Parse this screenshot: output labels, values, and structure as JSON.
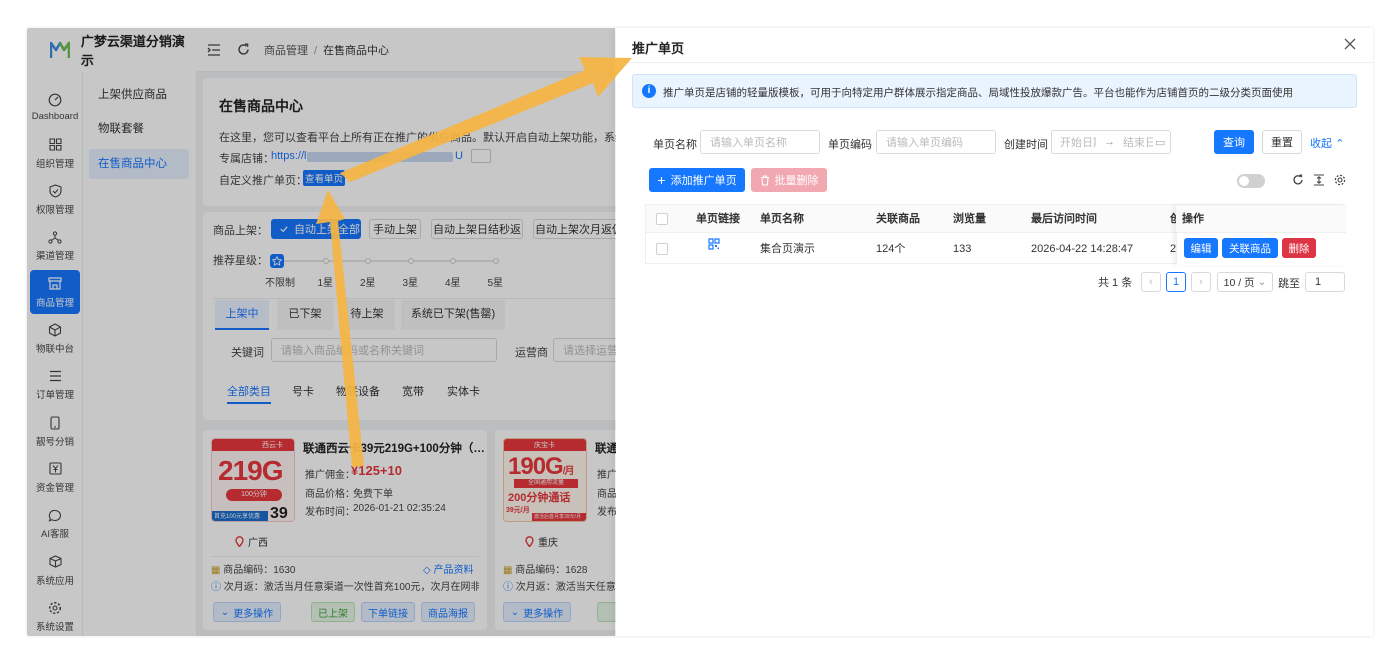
{
  "app": {
    "name": "广梦云渠道分销演示"
  },
  "rail": [
    {
      "label": "Dashboard",
      "icon": "dashboard-icon"
    },
    {
      "label": "组织管理",
      "icon": "grid-icon"
    },
    {
      "label": "权限管理",
      "icon": "shield-icon"
    },
    {
      "label": "渠道管理",
      "icon": "network-icon"
    },
    {
      "label": "商品管理",
      "icon": "store-icon",
      "active": true
    },
    {
      "label": "物联中台",
      "icon": "cube-icon"
    },
    {
      "label": "订单管理",
      "icon": "list-icon"
    },
    {
      "label": "靓号分销",
      "icon": "phone-icon"
    },
    {
      "label": "资金管理",
      "icon": "yen-icon"
    },
    {
      "label": "AI客服",
      "icon": "chat-icon"
    },
    {
      "label": "系统应用",
      "icon": "box-icon"
    },
    {
      "label": "系统设置",
      "icon": "gear-icon"
    }
  ],
  "submenu": [
    {
      "label": "上架供应商品"
    },
    {
      "label": "物联套餐"
    },
    {
      "label": "在售商品中心",
      "active": true
    }
  ],
  "breadcrumb": {
    "a": "商品管理",
    "sep": "/",
    "b": "在售商品中心"
  },
  "main": {
    "title": "在售商品中心",
    "desc": "在这里，您可以查看平台上所有正在推广的供应商品。默认开启自动上架功能，系统会将平台",
    "shop_label": "专属店铺：",
    "shop_url": "https://l",
    "shop_url_tail": "U",
    "custom_label": "自定义推广单页：",
    "view_btn": "查看单页",
    "shelf_label": "商品上架：",
    "shelf_opts": [
      "自动上架全部",
      "手动上架",
      "自动上架日结秒返",
      "自动上架次月返佣"
    ],
    "star_label": "推荐星级：",
    "stars": [
      "不限制",
      "1星",
      "2星",
      "3星",
      "4星",
      "5星"
    ],
    "tabs": [
      "上架中",
      "已下架",
      "待上架",
      "系统已下架(售罄)"
    ],
    "keyword_label": "关键词",
    "keyword_ph": "请输入商品编码或名称关键词",
    "operator_label": "运营商",
    "operator_ph": "请选择运营商",
    "cats": [
      "全部类目",
      "号卡",
      "物联设备",
      "宽带",
      "实体卡"
    ]
  },
  "products": [
    {
      "title": "联通西云卡39元219G+100分钟（…",
      "img_big": "219G",
      "img_sub": "100分钟",
      "img_tag": "首充100元享优惠",
      "img_price": "39",
      "img_brand": "西云卡",
      "commission_label": "推广佣金：",
      "commission": "¥125+10",
      "price_label": "商品价格：",
      "price": "免费下单",
      "time_label": "发布时间：",
      "time": "2026-01-21 02:35:24",
      "region": "广西",
      "code_label": "商品编码：",
      "code": "1630",
      "material": "产品资料",
      "rebate_label": "次月返：",
      "rebate": "激活当月任意渠道一次性首充100元，次月在网非…",
      "more": "更多操作",
      "listed": "已上架",
      "link": "下单链接",
      "poster": "商品海报"
    },
    {
      "title": "联通",
      "img_big": "190G",
      "img_unit": "/月",
      "img_sub": "200分钟通话",
      "img_line": "全国通用流量",
      "img_tag": "激活后首月享39元/月",
      "img_price": "39元/月",
      "img_brand": "庆宝卡",
      "commission_label": "推广",
      "price_label": "商品",
      "time_label": "发布",
      "region": "重庆",
      "code_label": "商品编码：",
      "code": "1628",
      "rebate_label": "次月返：",
      "rebate": "激活当天任意渠",
      "more": "更多操作"
    }
  ],
  "drawer": {
    "title": "推广单页",
    "info": "推广单页是店铺的轻量版模板，可用于向特定用户群体展示指定商品、局域性投放爆款广告。平台也能作为店铺首页的二级分类页面使用",
    "name_label": "单页名称",
    "name_ph": "请输入单页名称",
    "code_label": "单页编码",
    "code_ph": "请输入单页编码",
    "time_label": "创建时间",
    "start_ph": "开始日期",
    "end_ph": "结束日期",
    "query": "查询",
    "reset": "重置",
    "collapse": "收起",
    "add": "添加推广单页",
    "batch_delete": "批量删除",
    "columns": [
      "单页链接",
      "单页名称",
      "关联商品",
      "浏览量",
      "最后访问时间",
      "创",
      "操作"
    ],
    "rows": [
      {
        "name": "集合页演示",
        "goods": "124个",
        "views": "133",
        "last_visit": "2026-04-22 14:28:47",
        "created": "2",
        "edit": "编辑",
        "link": "关联商品",
        "del": "删除"
      }
    ],
    "total": "共 1 条",
    "page": "1",
    "page_size": "10 / 页",
    "jump_label": "跳至",
    "jump_value": "1"
  },
  "colors": {
    "primary": "#1677ff",
    "danger": "#dc3545",
    "arrow": "#f5b544",
    "price": "#e8383d"
  }
}
